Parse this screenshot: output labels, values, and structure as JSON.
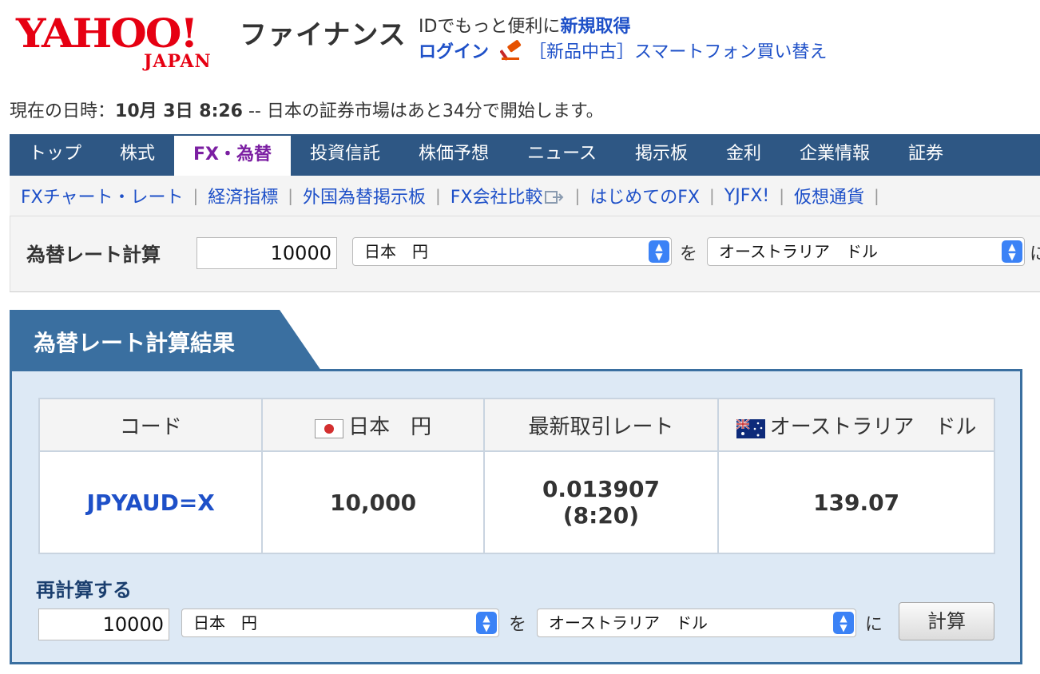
{
  "header": {
    "logo_text": "YAHOO!",
    "logo_sub": "JAPAN",
    "service_name": "ファイナンス",
    "id_text": "IDでもっと便利に",
    "signup_link": "新規取得",
    "login_link": "ログイン",
    "promo_link": "［新品中古］スマートフォン買い替え"
  },
  "dateline": {
    "prefix": "現在の日時：",
    "datetime": "10月 3日 8:26",
    "message": " -- 日本の証券市場はあと34分で開始します。"
  },
  "gnav": {
    "tabs": [
      "トップ",
      "株式",
      "FX・為替",
      "投資信託",
      "株価予想",
      "ニュース",
      "掲示板",
      "金利",
      "企業情報",
      "証券"
    ]
  },
  "subnav": {
    "items": [
      "FXチャート・レート",
      "経済指標",
      "外国為替掲示板",
      "FX会社比較",
      "はじめてのFX",
      "YJFX!",
      "仮想通貨"
    ],
    "separator": "|"
  },
  "calcbar": {
    "label": "為替レート計算",
    "amount": "10000",
    "from_currency": "日本　円",
    "conj_wo": "を",
    "to_currency": "オーストラリア　ドル",
    "conj_ni": "に"
  },
  "result": {
    "title": "為替レート計算結果",
    "headers": {
      "code": "コード",
      "from": "日本　円",
      "rate": "最新取引レート",
      "to": "オーストラリア　ドル"
    },
    "row": {
      "code": "JPYAUD=X",
      "amount": "10,000",
      "rate": "0.013907",
      "rate_time": "(8:20)",
      "converted": "139.07"
    }
  },
  "recalc": {
    "label": "再計算する",
    "amount": "10000",
    "from_currency": "日本　円",
    "conj_wo": "を",
    "to_currency": "オーストラリア　ドル",
    "conj_ni": "に",
    "button": "計算"
  },
  "colors": {
    "nav_bg": "#2e5784",
    "link_blue": "#1e50c8",
    "brand_red": "#e60012",
    "active_tab": "#7b1fa2",
    "panel_bg": "#dde9f5"
  }
}
